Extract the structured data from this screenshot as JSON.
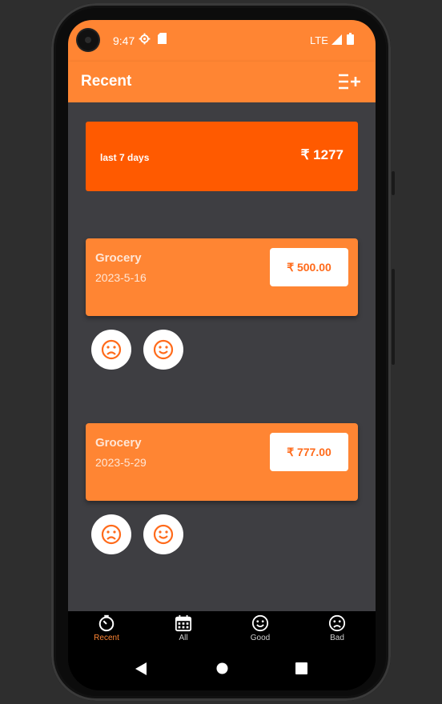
{
  "status_bar": {
    "time": "9:47",
    "network": "LTE"
  },
  "app_bar": {
    "title": "Recent",
    "action_icon": "playlist-add-icon"
  },
  "summary": {
    "label": "last 7 days",
    "currency": "₹",
    "total": "1277"
  },
  "transactions": [
    {
      "category": "Grocery",
      "date": "2023-5-16",
      "amount": "₹ 500.00"
    },
    {
      "category": "Grocery",
      "date": "2023-5-29",
      "amount": "₹ 777.00"
    }
  ],
  "bottom_nav": [
    {
      "label": "Recent",
      "icon": "timer-icon",
      "active": true
    },
    {
      "label": "All",
      "icon": "calendar-icon",
      "active": false
    },
    {
      "label": "Good",
      "icon": "smile-icon",
      "active": false
    },
    {
      "label": "Bad",
      "icon": "sad-icon",
      "active": false
    }
  ],
  "colors": {
    "primary": "#ff8533",
    "summary": "#ff5a00",
    "background": "#3e3e42"
  }
}
